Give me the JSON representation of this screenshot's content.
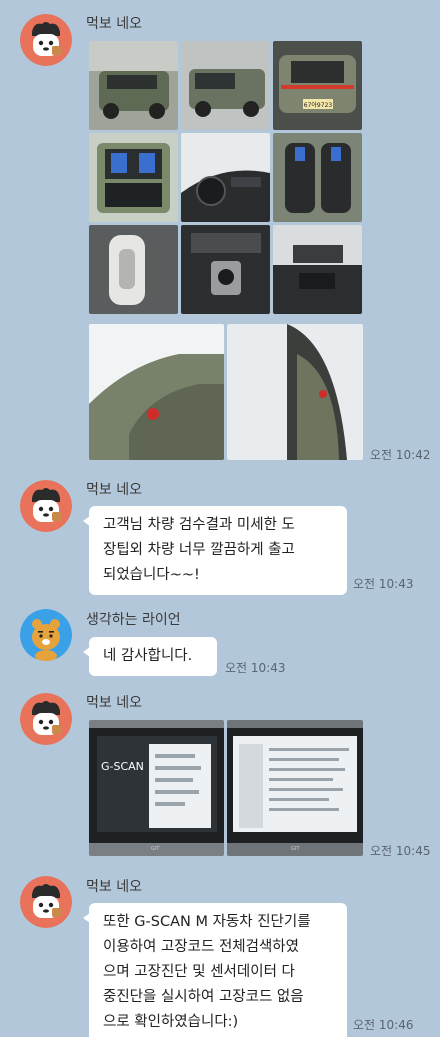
{
  "messages": [
    {
      "sender": "먹보 네오",
      "type": "photos",
      "photo_count": 11,
      "time": "오전 10:42"
    },
    {
      "sender": "먹보 네오",
      "type": "text",
      "text": "고객님 차량 검수결과 미세한 도\n장팁외 차량 너무 깔끔하게 출고\n되었습니다~~!",
      "time": "오전 10:43"
    },
    {
      "sender": "생각하는 라이언",
      "type": "text",
      "text": "네 감사합니다.",
      "time": "오전 10:43"
    },
    {
      "sender": "먹보 네오",
      "type": "photos",
      "photo_count": 2,
      "time": "오전 10:45"
    },
    {
      "sender": "먹보 네오",
      "type": "text",
      "text": "또한 G-SCAN M 자동차 진단기를\n 이용하여 고장코드 전체검색하였\n으며 고장진단 및 센서데이터 다\n중진단을 실시하여 고장코드 없음\n으로 확인하였습니다:)",
      "time": "오전 10:46"
    }
  ],
  "photo_text": {
    "plate": "67아9723",
    "scanner_brand": "G-SCAN",
    "device_brand": "GIT"
  },
  "colors": {
    "background": "#b2c7d9",
    "bubble": "#ffffff",
    "neo_avatar_bg": "#e9725b",
    "ryan_avatar_bg": "#3aa0e8"
  },
  "avatars": {
    "neo": "neo-character-icon",
    "ryan": "ryan-character-icon"
  }
}
